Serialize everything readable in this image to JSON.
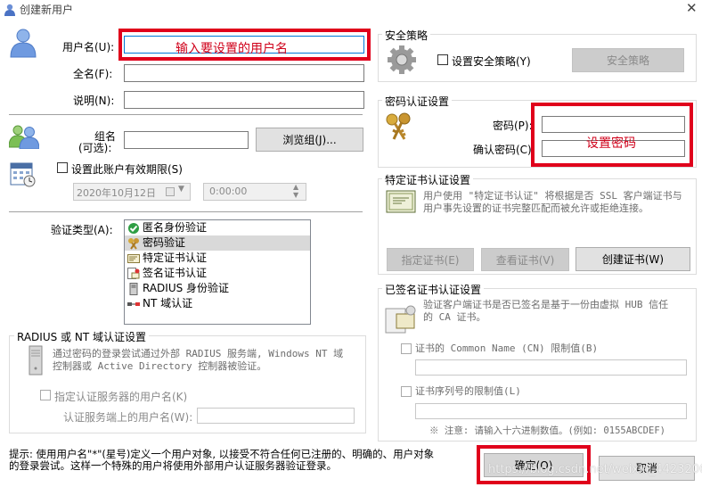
{
  "title": "创建新用户",
  "close": "✕",
  "fields": {
    "username_label": "用户名(U):",
    "username_value": "输入要设置的用户名",
    "fullname_label": "全名(F):",
    "desc_label": "说明(N):",
    "group_label_1": "组名",
    "group_label_2": "(可选):",
    "browse_btn": "浏览组(J)...",
    "expire_label": "设置此账户有效期限(S)",
    "date": "2020年10月12日",
    "time": "0:00:00",
    "auth_label": "验证类型(A):"
  },
  "auth_types": [
    {
      "label": "匿名身份验证",
      "icon": "check-circle-icon"
    },
    {
      "label": "密码验证",
      "icon": "keys-icon"
    },
    {
      "label": "特定证书认证",
      "icon": "certificate-icon"
    },
    {
      "label": "签名证书认证",
      "icon": "signed-cert-icon"
    },
    {
      "label": "RADIUS 身份验证",
      "icon": "server-icon"
    },
    {
      "label": "NT 域认证",
      "icon": "network-icon"
    }
  ],
  "radius": {
    "title": "RADIUS 或 NT 域认证设置",
    "desc": "通过密码的登录尝试通过外部 RADIUS 服务端, Windows NT 域控制器或 Active Directory 控制器被验证。",
    "desc_l1": "通过密码的登录尝试通过外部 RADIUS 服务端, Windows NT 域",
    "desc_l2": "控制器或 Active Directory 控制器被验证。",
    "check_label": "指定认证服务器的用户名(K)",
    "server_user_label": "认证服务端上的用户名(W):"
  },
  "security": {
    "title": "安全策略",
    "check_label": "设置安全策略(Y)",
    "btn": "安全策略"
  },
  "password": {
    "title": "密码认证设置",
    "pw_label": "密码(P):",
    "confirm_label": "确认密码(C):",
    "annotation": "设置密码"
  },
  "cert": {
    "title": "特定证书认证设置",
    "desc_l1": "用户使用 \"特定证书认证\" 将根据是否 SSL 客户端证书与",
    "desc_l2": "用户事先设置的证书完整匹配而被允许或拒绝连接。",
    "btn_specify": "指定证书(E)",
    "btn_view": "查看证书(V)",
    "btn_create": "创建证书(W)"
  },
  "signed": {
    "title": "已签名证书认证设置",
    "desc_l1": "验证客户端证书是否已签名是基于一份由虚拟 HUB 信任",
    "desc_l2": "的 CA 证书。",
    "cn_label": "证书的 Common Name (CN) 限制值(B)",
    "serial_label": "证书序列号的限制值(L)",
    "note": "※ 注意: 请输入十六进制数值。(例如: 0155ABCDEF)"
  },
  "hint_l1": "提示: 使用用户名\"*\"(星号)定义一个用户对象, 以接受不符合任何已注册的、明确的、用户对象",
  "hint_l2": "的登录尝试。这样一个特殊的用户将使用外部用户认证服务器验证登录。",
  "ok_btn": "确定(O)",
  "cancel_btn": "取消",
  "watermark": "https://blog.csdn.net/weixin_44232062",
  "colors": {
    "accent": "#e0001b",
    "annotation_text": "#d0021b"
  }
}
